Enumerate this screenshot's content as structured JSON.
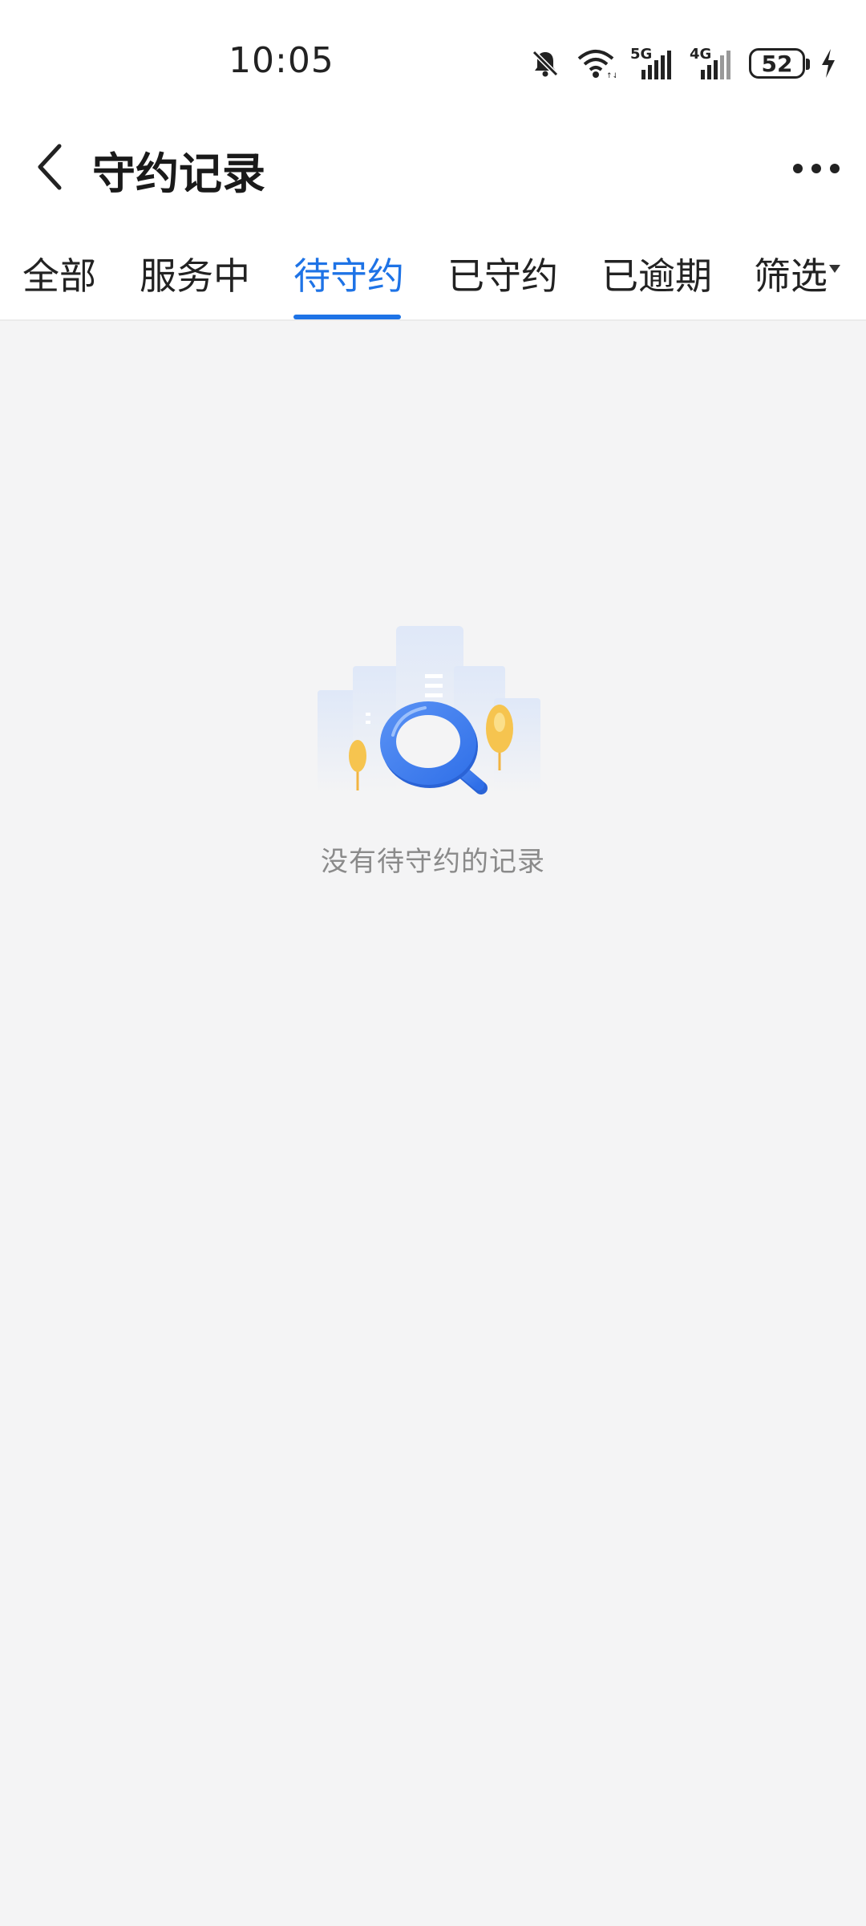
{
  "status_bar": {
    "time": "10:05",
    "signal_1_label": "5G",
    "signal_2_label": "4G",
    "battery_level": "52",
    "icons": [
      "bell-off-icon",
      "wifi-icon",
      "signal-5g-icon",
      "signal-4g-icon",
      "battery-icon",
      "charging-icon"
    ]
  },
  "nav": {
    "title": "守约记录",
    "back_icon": "chevron-left-icon",
    "more_icon": "more-horizontal-icon"
  },
  "tabs": [
    {
      "label": "全部",
      "active": false
    },
    {
      "label": "服务中",
      "active": false
    },
    {
      "label": "待守约",
      "active": true
    },
    {
      "label": "已守约",
      "active": false
    },
    {
      "label": "已逾期",
      "active": false
    },
    {
      "label": "筛选",
      "active": false
    }
  ],
  "empty_state": {
    "message": "没有待守约的记录",
    "illustration": "magnifier-buildings-illustration"
  },
  "colors": {
    "accent": "#1e73e6",
    "background": "#f4f4f5",
    "illustration_blue": "#3b7cf0",
    "illustration_yellow": "#f6c44f"
  }
}
